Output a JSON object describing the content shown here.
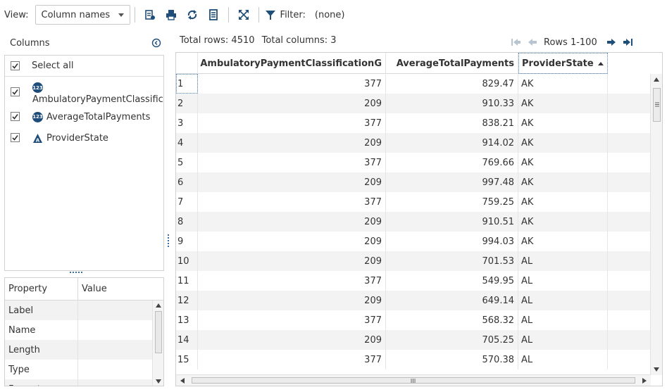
{
  "toolbar": {
    "view_label": "View:",
    "view_selected": "Column names",
    "filter_label": "Filter:",
    "filter_value": "(none)",
    "icons": [
      "data-source-icon",
      "print-icon",
      "refresh-icon",
      "columns-icon",
      "expand-icon",
      "filter-icon"
    ]
  },
  "columns_panel": {
    "title": "Columns",
    "select_all_label": "Select all",
    "items": [
      {
        "name": "AmbulatoryPaymentClassific",
        "type_badge": "123",
        "checked": true
      },
      {
        "name": "AverageTotalPayments",
        "type_badge": "123",
        "checked": true
      },
      {
        "name": "ProviderState",
        "type_badge": "A",
        "checked": true
      }
    ]
  },
  "properties": {
    "headers": [
      "Property",
      "Value"
    ],
    "rows": [
      "Label",
      "Name",
      "Length",
      "Type",
      "Format"
    ]
  },
  "grid_info": {
    "total_rows": "Total rows: 4510",
    "total_columns": "Total columns: 3"
  },
  "pager": {
    "rows_label": "Rows 1-100"
  },
  "grid": {
    "headers": [
      "AmbulatoryPaymentClassificationG",
      "AverageTotalPayments",
      "ProviderState"
    ],
    "sorted_column": "ProviderState",
    "rows": [
      [
        "1",
        "377",
        "829.47",
        "AK"
      ],
      [
        "2",
        "209",
        "910.33",
        "AK"
      ],
      [
        "3",
        "377",
        "838.21",
        "AK"
      ],
      [
        "4",
        "209",
        "914.02",
        "AK"
      ],
      [
        "5",
        "377",
        "769.66",
        "AK"
      ],
      [
        "6",
        "209",
        "997.48",
        "AK"
      ],
      [
        "7",
        "377",
        "759.25",
        "AK"
      ],
      [
        "8",
        "209",
        "910.51",
        "AK"
      ],
      [
        "9",
        "209",
        "994.03",
        "AK"
      ],
      [
        "10",
        "209",
        "701.53",
        "AL"
      ],
      [
        "11",
        "377",
        "549.95",
        "AL"
      ],
      [
        "12",
        "209",
        "649.14",
        "AL"
      ],
      [
        "13",
        "377",
        "568.32",
        "AL"
      ],
      [
        "14",
        "209",
        "705.25",
        "AL"
      ],
      [
        "15",
        "377",
        "570.38",
        "AL"
      ]
    ]
  },
  "colors": {
    "accent": "#1e4c7a",
    "icon": "#1f4e79",
    "focus": "#4a7fb5"
  }
}
